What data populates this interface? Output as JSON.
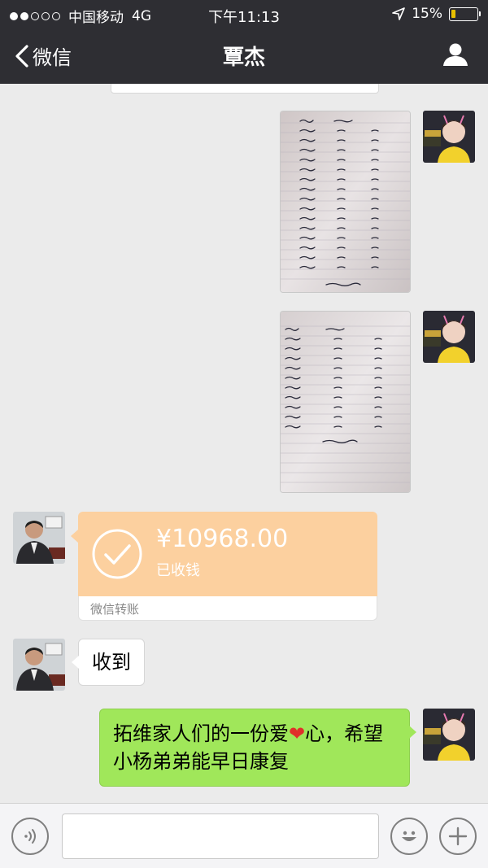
{
  "status_bar": {
    "carrier": "中国移动",
    "network": "4G",
    "time": "下午11:13",
    "battery": "15%",
    "battery_level": 0.15
  },
  "nav": {
    "back_label": "微信",
    "title": "覃杰"
  },
  "messages": {
    "transfer": {
      "amount": "¥10968.00",
      "status": "已收钱",
      "footer": "微信转账"
    },
    "text_received": "收到",
    "text_sent_part1": "拓维家人们的一份爱",
    "text_sent_part2": "心，希望小杨弟弟能早日康复"
  },
  "icons": {
    "back": "chevron-left-icon",
    "profile": "person-icon",
    "voice": "voice-icon",
    "emoji": "emoji-icon",
    "plus": "plus-icon"
  },
  "colors": {
    "nav_bg": "#2e2e33",
    "chat_bg": "#ebebeb",
    "transfer_bg": "#fcd09f",
    "sent_bubble": "#a0e75a"
  }
}
